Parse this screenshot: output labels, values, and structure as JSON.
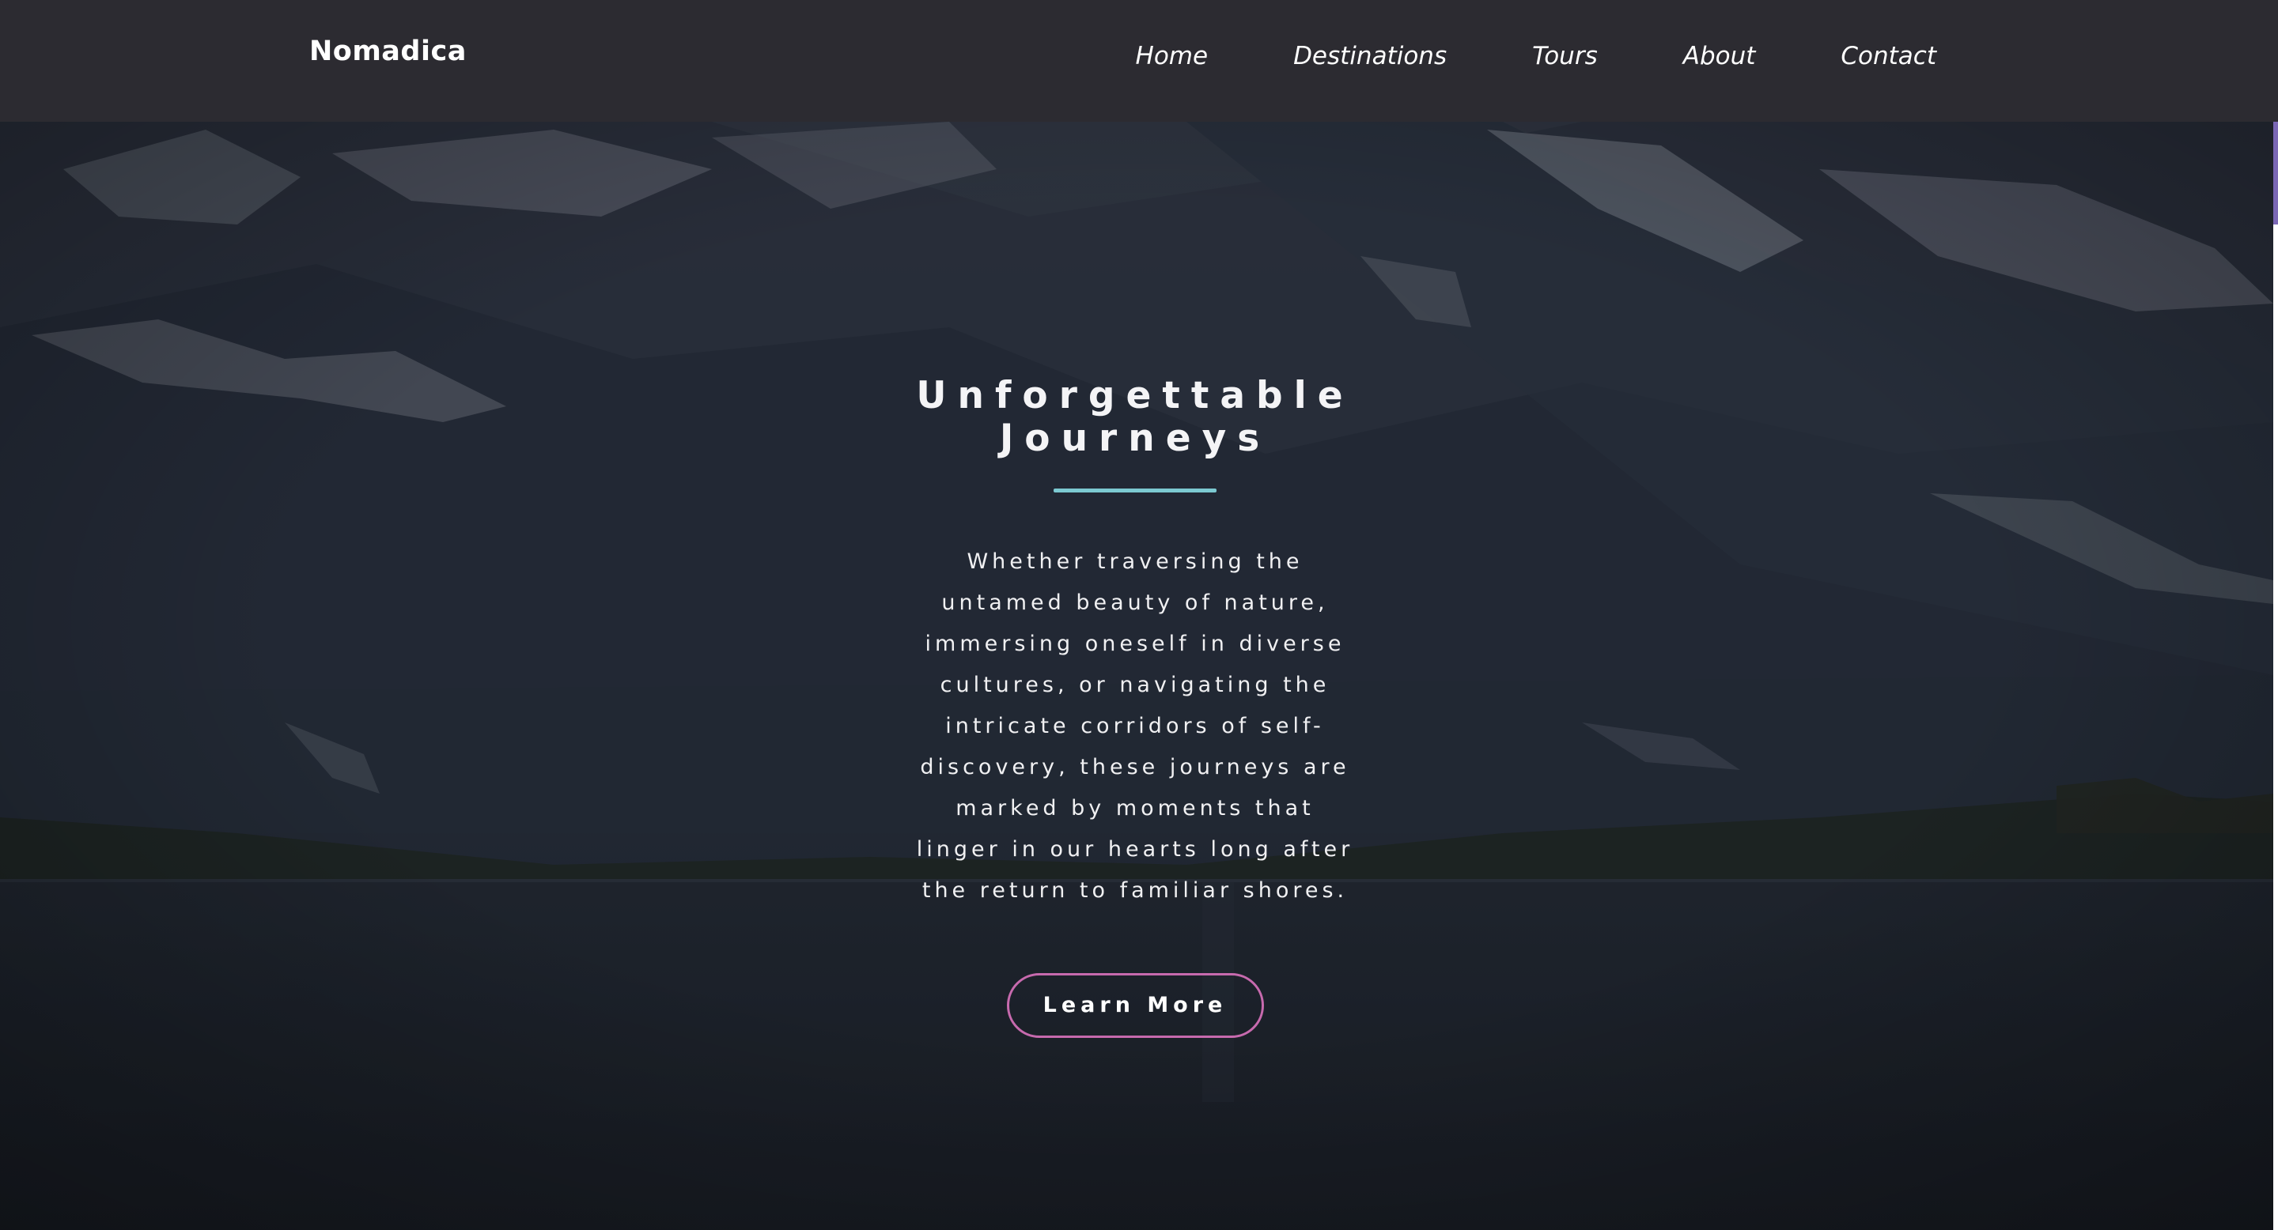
{
  "nav": {
    "brand": "Nomadica",
    "links": [
      "Home",
      "Destinations",
      "Tours",
      "About",
      "Contact"
    ]
  },
  "hero": {
    "title_line1": "Unforgettable",
    "title_line2": "Journeys",
    "paragraph": "Whether traversing the untamed beauty of nature, immersing oneself in diverse cultures, or navigating the intricate corridors of self-discovery, these journeys are marked by moments that linger in our hearts long after the return to familiar shores.",
    "cta_label": "Learn More"
  },
  "colors": {
    "nav_background": "#2c2b31",
    "hero_overlay": "#1f242d",
    "divider_accent": "#7cc9d1",
    "button_border": "#c76aae",
    "text": "#ffffff"
  }
}
